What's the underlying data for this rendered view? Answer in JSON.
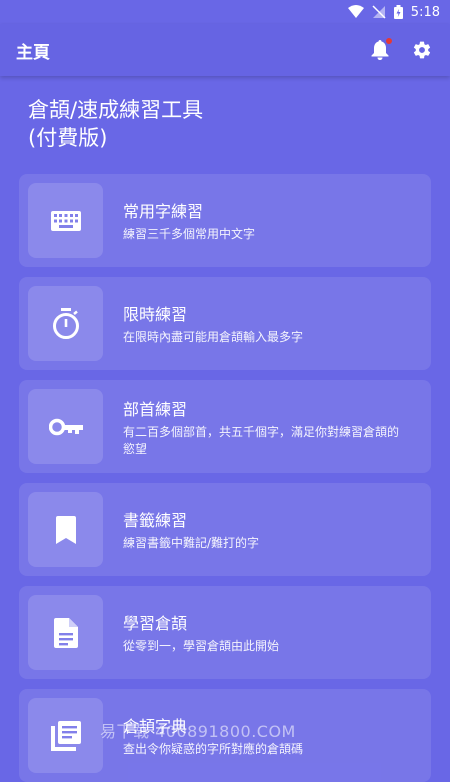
{
  "status_bar": {
    "time": "5:18"
  },
  "app_bar": {
    "title": "主頁"
  },
  "heading": {
    "line1": "倉頡/速成練習工具",
    "line2": "(付費版)"
  },
  "items": [
    {
      "title": "常用字練習",
      "desc": "練習三千多個常用中文字",
      "icon": "keyboard-icon"
    },
    {
      "title": "限時練習",
      "desc": "在限時內盡可能用倉頡輸入最多字",
      "icon": "timer-icon"
    },
    {
      "title": "部首練習",
      "desc": "有二百多個部首，共五千個字，滿足你對練習倉頡的慾望",
      "icon": "key-icon"
    },
    {
      "title": "書籤練習",
      "desc": "練習書籤中難記/難打的字",
      "icon": "bookmark-icon"
    },
    {
      "title": "學習倉頡",
      "desc": "從零到一，學習倉頡由此開始",
      "icon": "document-icon"
    },
    {
      "title": "倉頡字典",
      "desc": "查出令你疑惑的字所對應的倉頡碼",
      "icon": "book-icon"
    }
  ],
  "watermark": "易下载 400891800.COM",
  "colors": {
    "background": "#6967e6",
    "accent_dot": "#e53935"
  }
}
